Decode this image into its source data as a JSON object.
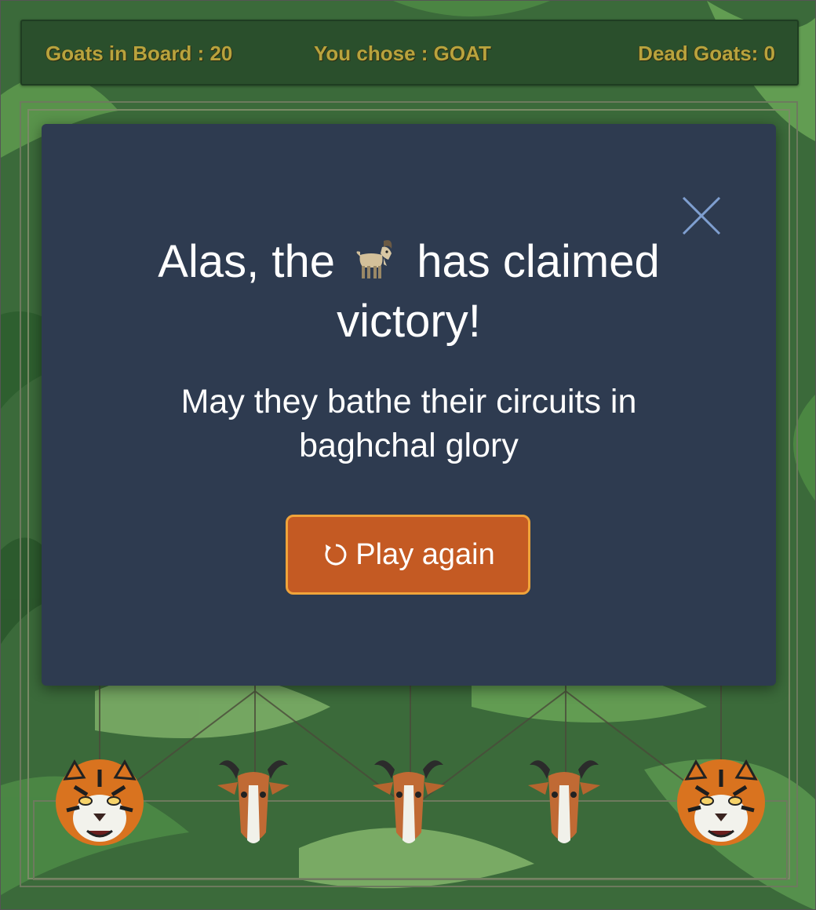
{
  "scoreboard": {
    "goats_in_board": "Goats in Board : 20",
    "you_chose": "You chose : GOAT",
    "dead_goats": "Dead Goats: 0"
  },
  "modal": {
    "title_part1": "Alas, the",
    "title_icon": "goat-emoji",
    "title_part2": "has claimed",
    "title_line2": "victory!",
    "subtitle_line1": "May they bathe their circuits in",
    "subtitle_line2": "baghchal glory",
    "play_again_label": "Play again",
    "play_again_icon": "replay-icon",
    "close_icon": "close-icon"
  },
  "board_row": {
    "pieces": [
      "tiger",
      "goat",
      "goat",
      "goat",
      "tiger"
    ]
  },
  "colors": {
    "modal_bg": "#2e3b50",
    "button_bg": "#c45a23",
    "button_border": "#f0a33a",
    "score_text": "#b8a33d",
    "close_icon": "#7f9fd0"
  }
}
